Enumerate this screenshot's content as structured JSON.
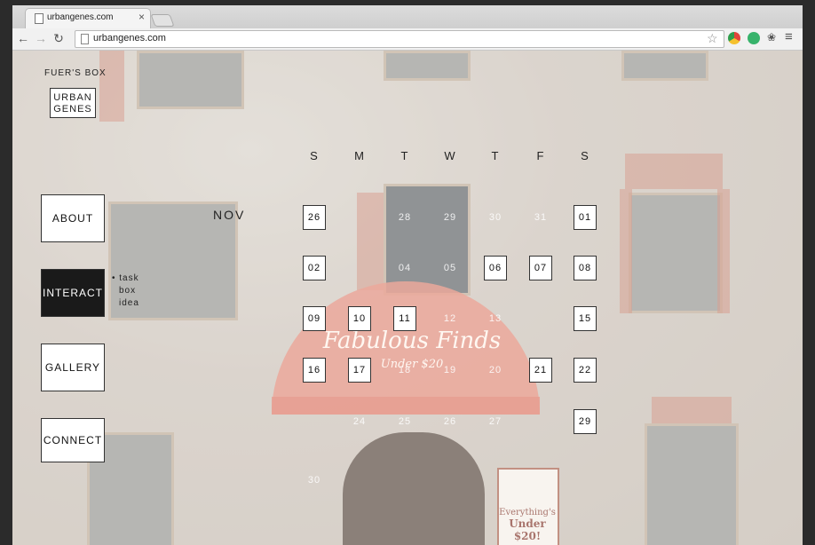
{
  "browser": {
    "tab_title": "urbangenes.com",
    "tab_close": "×",
    "url": "urbangenes.com",
    "icons": [
      "back-icon",
      "forward-icon",
      "reload-icon",
      "page-icon",
      "star-icon",
      "extension-icon",
      "puzzle-icon",
      "menu-icon"
    ]
  },
  "site": {
    "brand_top": "FUER'S BOX",
    "logo_line1": "URBAN",
    "logo_line2": "GENES",
    "nav": [
      {
        "label": "ABOUT"
      },
      {
        "label": "INTERACT"
      },
      {
        "label": "GALLERY"
      },
      {
        "label": "CONNECT"
      }
    ],
    "subnav": [
      "• task",
      "box",
      "idea"
    ]
  },
  "background": {
    "awning_line1": "Fabulous Finds",
    "awning_line2": "Under $20",
    "sign_line1": "Everything's",
    "sign_line2": "Under $20!"
  },
  "calendar": {
    "month": "NOV",
    "weekdays": [
      "S",
      "M",
      "T",
      "W",
      "T",
      "F",
      "S"
    ],
    "weeks": [
      [
        {
          "d": "26",
          "s": "box"
        },
        {
          "d": "",
          "s": ""
        },
        {
          "d": "",
          "s": ""
        },
        {
          "d": "28",
          "s": "ghost"
        },
        {
          "d": "29",
          "s": "ghost"
        },
        {
          "d": "30",
          "s": "ghost"
        },
        {
          "d": "31",
          "s": "ghost"
        },
        {
          "d": "01",
          "s": "box"
        }
      ],
      [
        {
          "d": "02",
          "s": "box"
        },
        {
          "d": "",
          "s": ""
        },
        {
          "d": "04",
          "s": "ghost"
        },
        {
          "d": "05",
          "s": "ghost"
        },
        {
          "d": "06",
          "s": "box"
        },
        {
          "d": "07",
          "s": "box"
        },
        {
          "d": "08",
          "s": "box"
        }
      ],
      [
        {
          "d": "09",
          "s": "box"
        },
        {
          "d": "10",
          "s": "box"
        },
        {
          "d": "11",
          "s": "box"
        },
        {
          "d": "12",
          "s": "ghost"
        },
        {
          "d": "13",
          "s": "ghost"
        },
        {
          "d": "",
          "s": ""
        },
        {
          "d": "15",
          "s": "box"
        }
      ],
      [
        {
          "d": "16",
          "s": "box"
        },
        {
          "d": "17",
          "s": "box"
        },
        {
          "d": "18",
          "s": "ghost"
        },
        {
          "d": "19",
          "s": "ghost"
        },
        {
          "d": "20",
          "s": "ghost"
        },
        {
          "d": "21",
          "s": "box"
        },
        {
          "d": "22",
          "s": "box"
        }
      ],
      [
        {
          "d": "",
          "s": ""
        },
        {
          "d": "24",
          "s": "ghost"
        },
        {
          "d": "25",
          "s": "ghost"
        },
        {
          "d": "26",
          "s": "ghost"
        },
        {
          "d": "27",
          "s": "ghost"
        },
        {
          "d": "",
          "s": ""
        },
        {
          "d": "29",
          "s": "box"
        }
      ],
      [
        {
          "d": "30",
          "s": "ghost"
        }
      ]
    ]
  }
}
